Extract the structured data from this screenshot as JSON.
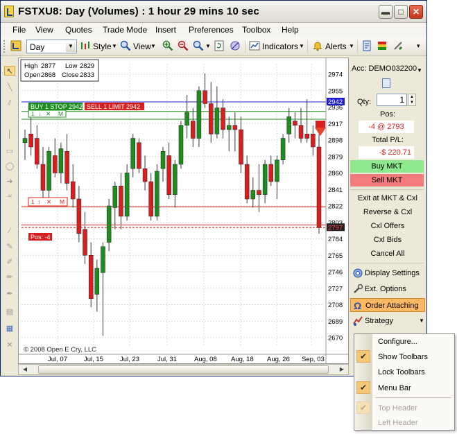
{
  "window": {
    "title": "FSTXU8: Day (Volumes) : 1 hour 29 mins 10 sec",
    "min_label": "▬",
    "max_label": "□",
    "close_label": "✕"
  },
  "menu": [
    "File",
    "View",
    "Quotes",
    "Trade Mode",
    "Insert",
    "Preferences",
    "Toolbox",
    "Help"
  ],
  "toolbar": {
    "period": "Day",
    "style_label": "Style",
    "view_label": "View",
    "indicators_label": "Indicators",
    "alerts_label": "Alerts"
  },
  "chart": {
    "info": {
      "high_label": "High",
      "high": "2877",
      "low_label": "Low",
      "low": "2829",
      "open_label": "Open",
      "open": "2868",
      "close_label": "Close",
      "close": "2833"
    },
    "orders": {
      "buy_stop": "BUY 1 STOP 2942",
      "sell_limit": "SELL 1 LIMIT 2942",
      "buy_row_qty": "1",
      "buy_row_m": "M",
      "sell_row_qty": "1",
      "sell_row_m": "M",
      "position": "Pos: -4"
    },
    "price_labels": {
      "blue": "2942",
      "last": "2797"
    },
    "copyright": "© 2008 Open E Cry, LLC",
    "scroll_left": "◀",
    "scroll_right": "▶"
  },
  "chart_data": {
    "type": "candlestick",
    "y_ticks": [
      2974,
      2955,
      2936,
      2917,
      2898,
      2879,
      2860,
      2841,
      2822,
      2803,
      2784,
      2765,
      2746,
      2727,
      2708,
      2689,
      2670
    ],
    "x_ticks": [
      "Jul, 07",
      "Jul, 15",
      "Jul, 23",
      "Jul, 31",
      "Aug, 08",
      "Aug, 18",
      "Aug, 26",
      "Sep, 03"
    ],
    "ylim": [
      2660,
      2990
    ],
    "grid": true,
    "up_color": "#1e8c1e",
    "down_color": "#d81e1e",
    "candles": [
      {
        "o": 2895,
        "h": 2910,
        "l": 2875,
        "c": 2900
      },
      {
        "o": 2905,
        "h": 2925,
        "l": 2880,
        "c": 2890
      },
      {
        "o": 2900,
        "h": 2915,
        "l": 2865,
        "c": 2870
      },
      {
        "o": 2870,
        "h": 2890,
        "l": 2830,
        "c": 2840
      },
      {
        "o": 2840,
        "h": 2890,
        "l": 2825,
        "c": 2885
      },
      {
        "o": 2880,
        "h": 2900,
        "l": 2855,
        "c": 2860
      },
      {
        "o": 2860,
        "h": 2895,
        "l": 2848,
        "c": 2888
      },
      {
        "o": 2885,
        "h": 2905,
        "l": 2840,
        "c": 2848
      },
      {
        "o": 2850,
        "h": 2870,
        "l": 2820,
        "c": 2830
      },
      {
        "o": 2830,
        "h": 2845,
        "l": 2780,
        "c": 2790
      },
      {
        "o": 2795,
        "h": 2815,
        "l": 2755,
        "c": 2765
      },
      {
        "o": 2765,
        "h": 2780,
        "l": 2705,
        "c": 2715
      },
      {
        "o": 2720,
        "h": 2760,
        "l": 2700,
        "c": 2750
      },
      {
        "o": 2745,
        "h": 2780,
        "l": 2672,
        "c": 2775
      },
      {
        "o": 2780,
        "h": 2830,
        "l": 2770,
        "c": 2822
      },
      {
        "o": 2820,
        "h": 2850,
        "l": 2795,
        "c": 2845
      },
      {
        "o": 2845,
        "h": 2860,
        "l": 2795,
        "c": 2810
      },
      {
        "o": 2810,
        "h": 2870,
        "l": 2805,
        "c": 2860
      },
      {
        "o": 2865,
        "h": 2905,
        "l": 2855,
        "c": 2900
      },
      {
        "o": 2895,
        "h": 2900,
        "l": 2860,
        "c": 2865
      },
      {
        "o": 2865,
        "h": 2880,
        "l": 2840,
        "c": 2850
      },
      {
        "o": 2850,
        "h": 2860,
        "l": 2805,
        "c": 2810
      },
      {
        "o": 2810,
        "h": 2870,
        "l": 2805,
        "c": 2862
      },
      {
        "o": 2865,
        "h": 2890,
        "l": 2850,
        "c": 2885
      },
      {
        "o": 2880,
        "h": 2895,
        "l": 2830,
        "c": 2835
      },
      {
        "o": 2835,
        "h": 2875,
        "l": 2820,
        "c": 2870
      },
      {
        "o": 2870,
        "h": 2920,
        "l": 2865,
        "c": 2915
      },
      {
        "o": 2915,
        "h": 2950,
        "l": 2900,
        "c": 2930
      },
      {
        "o": 2920,
        "h": 2935,
        "l": 2890,
        "c": 2900
      },
      {
        "o": 2900,
        "h": 2960,
        "l": 2890,
        "c": 2955
      },
      {
        "o": 2955,
        "h": 2975,
        "l": 2935,
        "c": 2940
      },
      {
        "o": 2940,
        "h": 2965,
        "l": 2895,
        "c": 2905
      },
      {
        "o": 2905,
        "h": 2960,
        "l": 2900,
        "c": 2935
      },
      {
        "o": 2935,
        "h": 2945,
        "l": 2900,
        "c": 2910
      },
      {
        "o": 2910,
        "h": 2925,
        "l": 2885,
        "c": 2915
      },
      {
        "o": 2915,
        "h": 2930,
        "l": 2885,
        "c": 2910
      },
      {
        "o": 2910,
        "h": 2925,
        "l": 2860,
        "c": 2870
      },
      {
        "o": 2870,
        "h": 2880,
        "l": 2825,
        "c": 2830
      },
      {
        "o": 2830,
        "h": 2855,
        "l": 2820,
        "c": 2840
      },
      {
        "o": 2840,
        "h": 2870,
        "l": 2815,
        "c": 2835
      },
      {
        "o": 2835,
        "h": 2875,
        "l": 2825,
        "c": 2870
      },
      {
        "o": 2870,
        "h": 2880,
        "l": 2845,
        "c": 2850
      },
      {
        "o": 2850,
        "h": 2880,
        "l": 2830,
        "c": 2875
      },
      {
        "o": 2875,
        "h": 2905,
        "l": 2870,
        "c": 2900
      },
      {
        "o": 2905,
        "h": 2935,
        "l": 2895,
        "c": 2925
      },
      {
        "o": 2920,
        "h": 2930,
        "l": 2900,
        "c": 2915
      },
      {
        "o": 2915,
        "h": 2935,
        "l": 2895,
        "c": 2900
      },
      {
        "o": 2905,
        "h": 2945,
        "l": 2895,
        "c": 2900
      },
      {
        "o": 2905,
        "h": 2915,
        "l": 2880,
        "c": 2890
      },
      {
        "o": 2890,
        "h": 2905,
        "l": 2790,
        "c": 2797
      }
    ],
    "lines": [
      {
        "value": 2942,
        "color": "#1c1cd0"
      },
      {
        "value": 2931,
        "color": "#1e8c1e"
      },
      {
        "value": 2922,
        "color": "#1e8c1e"
      },
      {
        "value": 2821,
        "color": "#d81e1e"
      },
      {
        "value": 2800,
        "color": "#d81e1e"
      },
      {
        "value": 2797,
        "color": "#d81e1e",
        "dashed": true
      }
    ]
  },
  "panel": {
    "account": "Acc: DEMO032200",
    "qty_label": "Qty:",
    "qty_value": "1",
    "pos_label": "Pos:",
    "pos_value": "-4 @ 2793",
    "pl_label": "Total P/L:",
    "pl_value": "-$ 220.71",
    "buy_mkt": "Buy MKT",
    "sell_mkt": "Sell MKT",
    "exit": "Exit at MKT & Cxl",
    "reverse": "Reverse & Cxl",
    "cxl_offers": "Cxl Offers",
    "cxl_bids": "Cxl Bids",
    "cancel_all": "Cancel All",
    "display_settings": "Display Settings",
    "ext_options": "Ext. Options",
    "order_attaching": "Order Attaching",
    "strategy": "Strategy"
  },
  "context_menu": {
    "configure": "Configure...",
    "show_toolbars": "Show Toolbars",
    "lock_toolbars": "Lock Toolbars",
    "menu_bar": "Menu Bar",
    "top_header": "Top Header",
    "left_header": "Left Header"
  }
}
